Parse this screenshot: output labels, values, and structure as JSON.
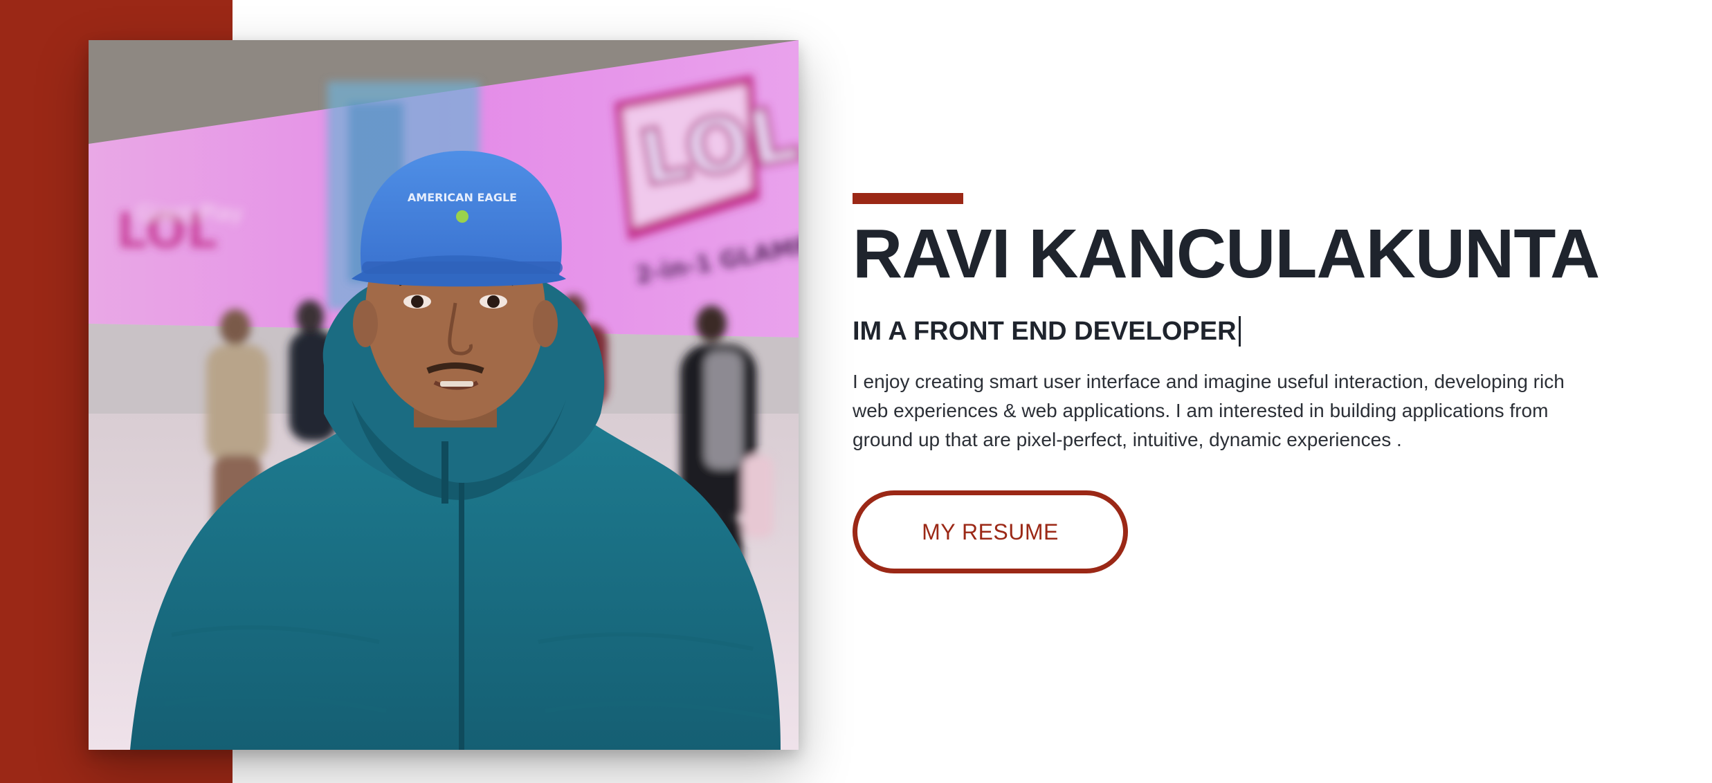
{
  "profile": {
    "name": "RAVI KANCULAKUNTA",
    "role": "IM A FRONT END DEVELOPER",
    "bio": "I enjoy creating smart user interface and imagine useful interaction, developing rich web experiences & web applications. I am interested in building applications from ground up that are pixel-perfect, intuitive, dynamic experiences .",
    "resume_label": "MY RESUME"
  },
  "photo": {
    "alt": "Portrait photo of Ravi Kanculakunta",
    "cap_text": "AMERICAN EAGLE",
    "billboard_text": "LOL",
    "billboard_subtext": "SURPRISE!"
  },
  "colors": {
    "accent": "#9b2816",
    "heading": "#1f242d",
    "body_text": "#2b2f36",
    "background": "#ffffff"
  }
}
